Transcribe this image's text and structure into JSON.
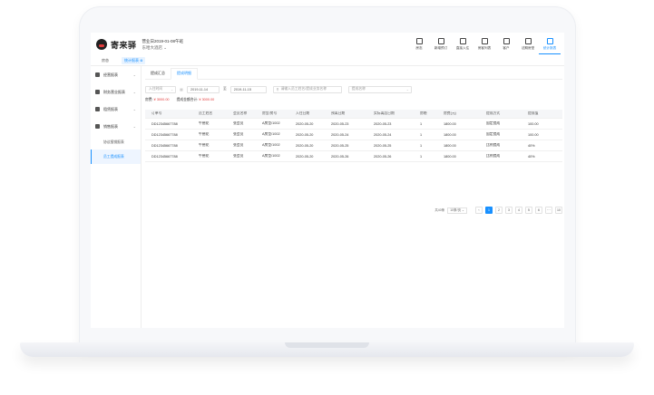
{
  "header": {
    "logo_text": "寄来驿",
    "business_date": "营业日2019-01-08午班",
    "store_name": "东哈大酒店 ⌄",
    "nav": [
      {
        "label": "房态",
        "icon": "monitor-icon"
      },
      {
        "label": "新增预订",
        "icon": "edit-icon"
      },
      {
        "label": "直接入住",
        "icon": "check-circle-icon"
      },
      {
        "label": "房客列表",
        "icon": "users-icon"
      },
      {
        "label": "客户",
        "icon": "user-icon"
      },
      {
        "label": "法期房型",
        "icon": "calendar-icon"
      },
      {
        "label": "统计报表",
        "icon": "chart-icon",
        "active": true
      }
    ]
  },
  "tabstrip": {
    "home": "房态",
    "current": "统计报表 ⊗"
  },
  "sidebar": {
    "items": [
      {
        "label": "经营报表",
        "icon": "report-icon"
      },
      {
        "label": "财务营业报表",
        "icon": "finance-icon"
      },
      {
        "label": "租赁报表",
        "icon": "lease-icon"
      },
      {
        "label": "销售报表",
        "icon": "sales-icon"
      }
    ],
    "sub_items": [
      {
        "label": "协议报销报表",
        "active": false
      },
      {
        "label": "员工提成报表",
        "active": true
      }
    ]
  },
  "main": {
    "subtabs": [
      {
        "label": "提成汇总",
        "active": false
      },
      {
        "label": "提成明细",
        "active": true
      }
    ],
    "filters": {
      "date_type": "入住时间",
      "start_date": "2019-11-14",
      "to": "至",
      "end_date": "2019-11-15",
      "search_placeholder": "请输入员工姓名/提成业务名称",
      "commission_type": "提成名称"
    },
    "summary": {
      "room_fee_label": "房费:",
      "room_fee_value": "¥ 3000.00",
      "commission_label": "提成金额合计:",
      "commission_value": "¥ 3000.00"
    },
    "table": {
      "columns": [
        "订单号",
        "员工姓名",
        "会员名称",
        "房型/房号",
        "入住日期",
        "预离日期",
        "实际离店日期",
        "房晚",
        "房费(元)",
        "提成方式",
        "提成值"
      ],
      "rows": [
        [
          "DD12345667788",
          "牛德花",
          "张会员",
          "A房型/1002",
          "2020-05-20",
          "2020-05-23",
          "2020-05-23",
          "1",
          "1800.00",
          "固定提成",
          "100.00"
        ],
        [
          "DD12345667788",
          "牛德花",
          "张会员",
          "A房型/1002",
          "2020-05-20",
          "2020-05-24",
          "2020-05-24",
          "1",
          "1800.00",
          "固定提成",
          "100.00"
        ],
        [
          "DD12345667788",
          "牛德花",
          "张会员",
          "A房型/1002",
          "2020-05-20",
          "2020-05-25",
          "2020-05-25",
          "1",
          "1800.00",
          "比例提成",
          "40%"
        ],
        [
          "DD12345667788",
          "牛德花",
          "张会员",
          "A房型/1002",
          "2020-05-20",
          "2020-05-26",
          "2020-05-26",
          "1",
          "1800.00",
          "比例提成",
          "40%"
        ]
      ]
    },
    "pagination": {
      "total": "共40条",
      "page_size": "10条/页 ⌄",
      "prev": "‹",
      "pages": [
        "1",
        "2",
        "3",
        "4",
        "5",
        "6"
      ],
      "ellipsis": "···",
      "last": "10",
      "current": "1"
    }
  }
}
